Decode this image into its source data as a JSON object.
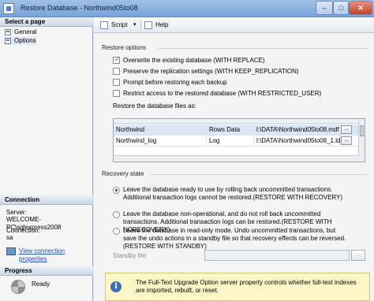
{
  "window": {
    "title": "Restore Database - Northwind05to08",
    "min_label": "–",
    "max_label": "□",
    "close_label": "✕"
  },
  "left": {
    "select_page_title": "Select a page",
    "pages": [
      {
        "label": "General",
        "icon": "page-icon"
      },
      {
        "label": "Options",
        "icon": "page-icon"
      }
    ],
    "connection_title": "Connection",
    "server_label": "Server:",
    "server_value": "WELCOME-PC\\sqlexpress2008",
    "connection_label": "Connection:",
    "connection_value": "sa",
    "view_link": "View connection properties",
    "progress_title": "Progress",
    "progress_status": "Ready"
  },
  "toolbar": {
    "script_label": "Script",
    "dropdown_glyph": "▾",
    "help_label": "Help"
  },
  "restore_options": {
    "group_label": "Restore options",
    "checkboxes": [
      {
        "label": "Overwrite the existing database (WITH REPLACE)",
        "checked": true
      },
      {
        "label": "Preserve the replication settings (WITH KEEP_REPLICATION)",
        "checked": false
      },
      {
        "label": "Prompt before restoring each backup",
        "checked": false
      },
      {
        "label": "Restrict access to the restored database (WITH RESTRICTED_USER)",
        "checked": false
      }
    ],
    "files_label": "Restore the database files as:",
    "files": [
      {
        "name": "Northwind",
        "type": "Rows Data",
        "path": "l:\\DATA\\Northwind05to08.mdf",
        "browse": "..."
      },
      {
        "name": "Northwind_log",
        "type": "Log",
        "path": "l:\\DATA\\Northwind05to08_1.ldf",
        "browse": "..."
      }
    ]
  },
  "recovery": {
    "group_label": "Recovery state",
    "options": [
      {
        "text": "Leave the database ready to use by rolling back uncommitted transactions. Additional transaction logs cannot be restored.(RESTORE WITH RECOVERY)",
        "selected": true
      },
      {
        "text": "Leave the database non-operational, and do not roll back uncommitted transactions. Additional transaction logs can be restored.(RESTORE WITH NORECOVERY)",
        "selected": false
      },
      {
        "text": "Leave the database in read-only mode. Undo uncommitted transactions, but save the undo actions in a standby file so that recovery effects can be reversed.(RESTORE WITH STANDBY)",
        "selected": false
      }
    ],
    "standby_label": "Standby file:",
    "standby_value": "",
    "standby_browse": "..."
  },
  "info": {
    "icon_glyph": "i",
    "text": "The Full-Text Upgrade Option server property controls whether full-text indexes are imported, rebuilt, or reset."
  }
}
